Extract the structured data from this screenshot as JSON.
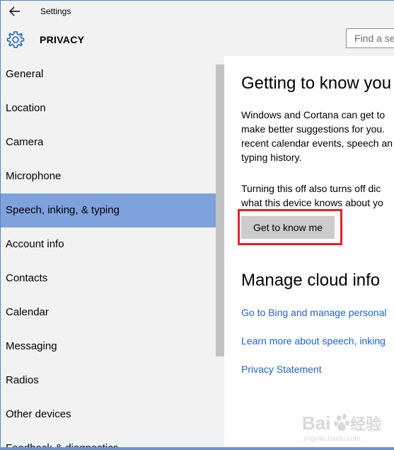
{
  "window": {
    "title": "Settings",
    "accent_color": "#7fa1dc"
  },
  "header": {
    "icon": "gear-icon",
    "section_title": "PRIVACY",
    "search_placeholder": "Find a se"
  },
  "sidebar": {
    "items": [
      {
        "label": "General",
        "active": false
      },
      {
        "label": "Location",
        "active": false
      },
      {
        "label": "Camera",
        "active": false
      },
      {
        "label": "Microphone",
        "active": false
      },
      {
        "label": "Speech, inking, & typing",
        "active": true
      },
      {
        "label": "Account info",
        "active": false
      },
      {
        "label": "Contacts",
        "active": false
      },
      {
        "label": "Calendar",
        "active": false
      },
      {
        "label": "Messaging",
        "active": false
      },
      {
        "label": "Radios",
        "active": false
      },
      {
        "label": "Other devices",
        "active": false
      },
      {
        "label": "Feedback & diagnostics",
        "active": false
      }
    ]
  },
  "content": {
    "heading1": "Getting to know you",
    "paragraph1": [
      "Windows and Cortana can get to",
      "make better suggestions for you.",
      "recent calendar events, speech an",
      "typing history."
    ],
    "paragraph2": [
      "Turning this off also turns off dic",
      "what this device knows about yo"
    ],
    "button_label": "Get to know me",
    "heading2": "Manage cloud info",
    "links": [
      "Go to Bing and manage personal",
      "Learn more about speech, inking",
      "Privacy Statement"
    ]
  },
  "watermark": {
    "brand": "Baidu",
    "subtitle": "jingyan.baidu.com"
  }
}
